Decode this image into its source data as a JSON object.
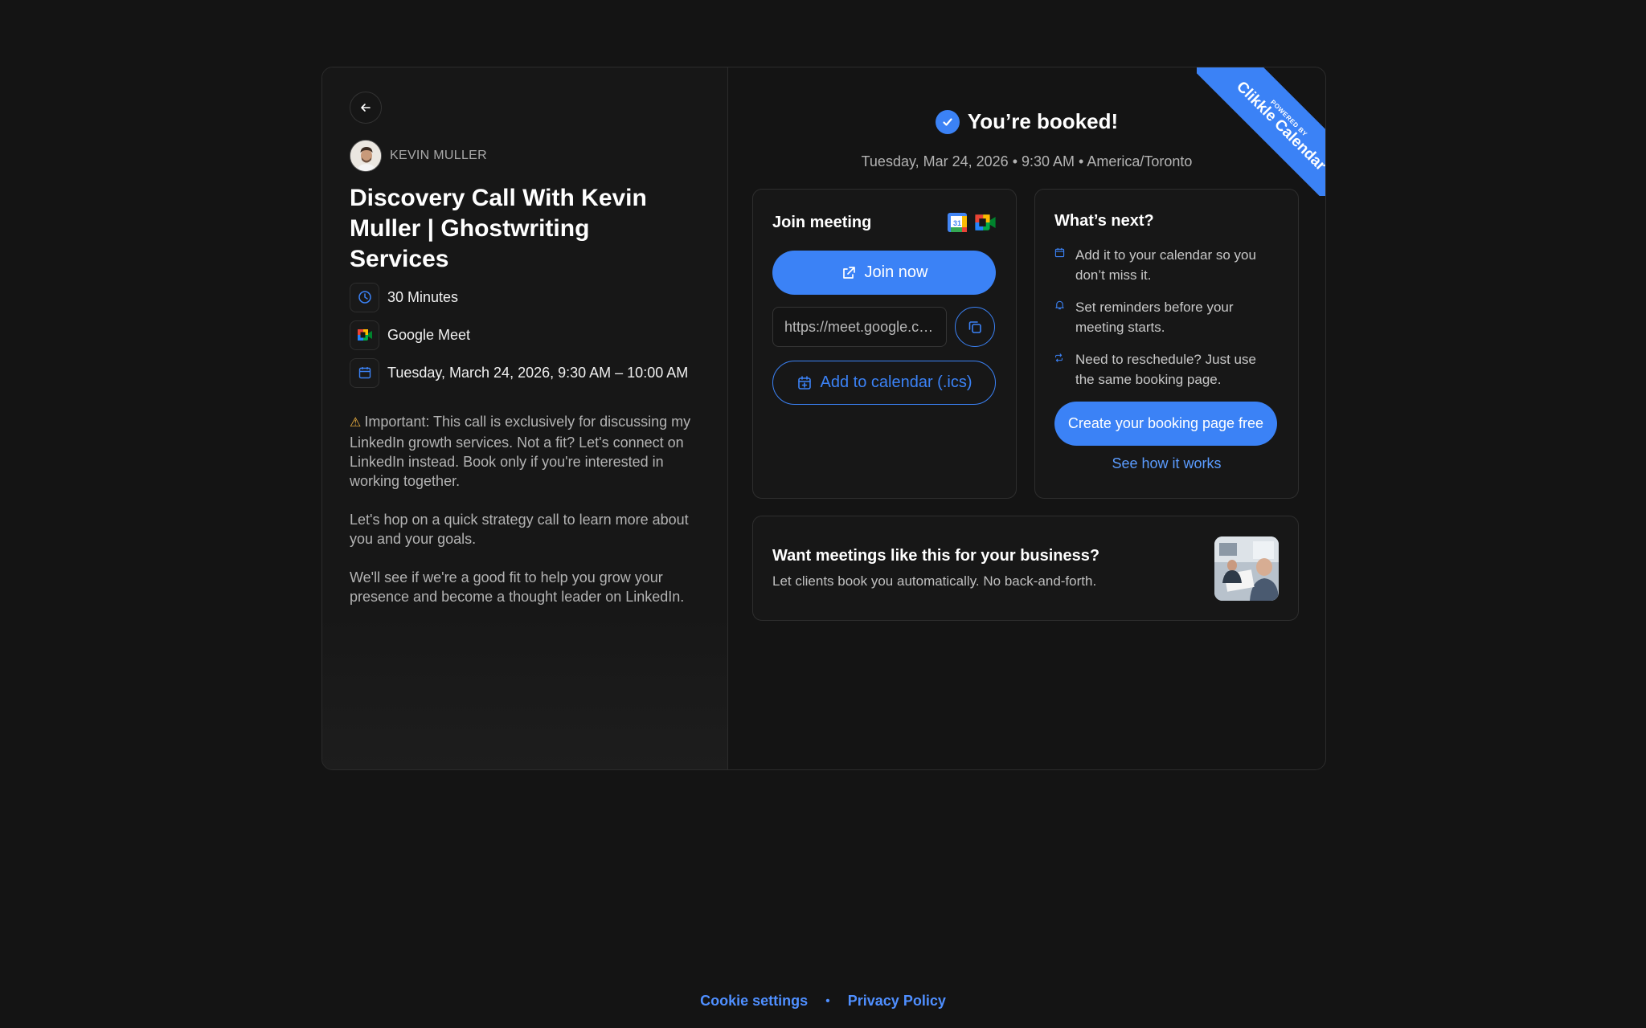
{
  "host": {
    "name": "KEVIN MULLER"
  },
  "event": {
    "title": "Discovery Call With Kevin Muller | Ghostwriting Services",
    "duration": "30 Minutes",
    "location": "Google Meet",
    "datetime": "Tuesday, March 24, 2026, 9:30 AM – 10:00 AM",
    "description": [
      "Important: This call is exclusively for discussing my LinkedIn growth services. Not a fit? Let's connect on LinkedIn instead. Book only if you're interested in working together.",
      "Let's hop on a quick strategy call to learn more about you and your goals.",
      "We'll see if we're a good fit to help you grow your presence and become a thought leader on LinkedIn."
    ]
  },
  "ribbon": {
    "small": "POWERED BY",
    "big": "Clikkle Calendar"
  },
  "booking": {
    "title": "You’re booked!",
    "subtitle": "Tuesday, Mar 24, 2026 • 9:30 AM • America/Toronto"
  },
  "join": {
    "title": "Join meeting",
    "join_label": "Join now",
    "link_value": "https://meet.google.com/",
    "link_display": "https://meet.google.c…",
    "add_calendar_label": "Add to calendar (.ics)"
  },
  "next": {
    "title": "What’s next?",
    "items": [
      "Add it to your calendar so you don’t miss it.",
      "Set reminders before your meeting starts.",
      "Need to reschedule? Just use the same booking page."
    ],
    "create_label": "Create your booking page free",
    "see_how_label": "See how it works"
  },
  "promo": {
    "title": "Want meetings like this for your business?",
    "subtitle": "Let clients book you automatically. No back-and-forth."
  },
  "footer": {
    "cookie": "Cookie settings",
    "separator": "•",
    "privacy": "Privacy Policy"
  },
  "colors": {
    "accent": "#3b82f6",
    "background": "#141414",
    "warning": "#f5b642"
  }
}
